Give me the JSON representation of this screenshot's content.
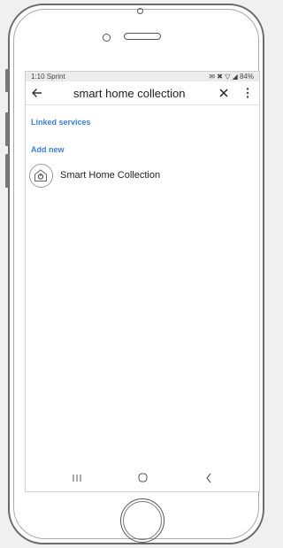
{
  "status_bar": {
    "time_carrier": "1:10 Sprint",
    "indicators": "✉ ✖ ▽ ◢ 84%",
    "battery_level": 84
  },
  "toolbar": {
    "back_icon": "arrow-left-icon",
    "search_query": "smart home collection",
    "clear_icon": "close-icon",
    "more_icon": "more-vertical-icon"
  },
  "sections": {
    "linked": "Linked services",
    "add_new": "Add new"
  },
  "services": [
    {
      "name": "Smart Home Collection",
      "icon": "smart-home-house-power-icon"
    }
  ],
  "nav_bar": {
    "recent_icon": "recent-apps-icon",
    "home_icon": "home-circle-icon",
    "back_icon": "back-chevron-icon"
  },
  "colors": {
    "accent": "#3c7fe0",
    "text": "#202124",
    "status_bar_bg": "#ececec"
  }
}
